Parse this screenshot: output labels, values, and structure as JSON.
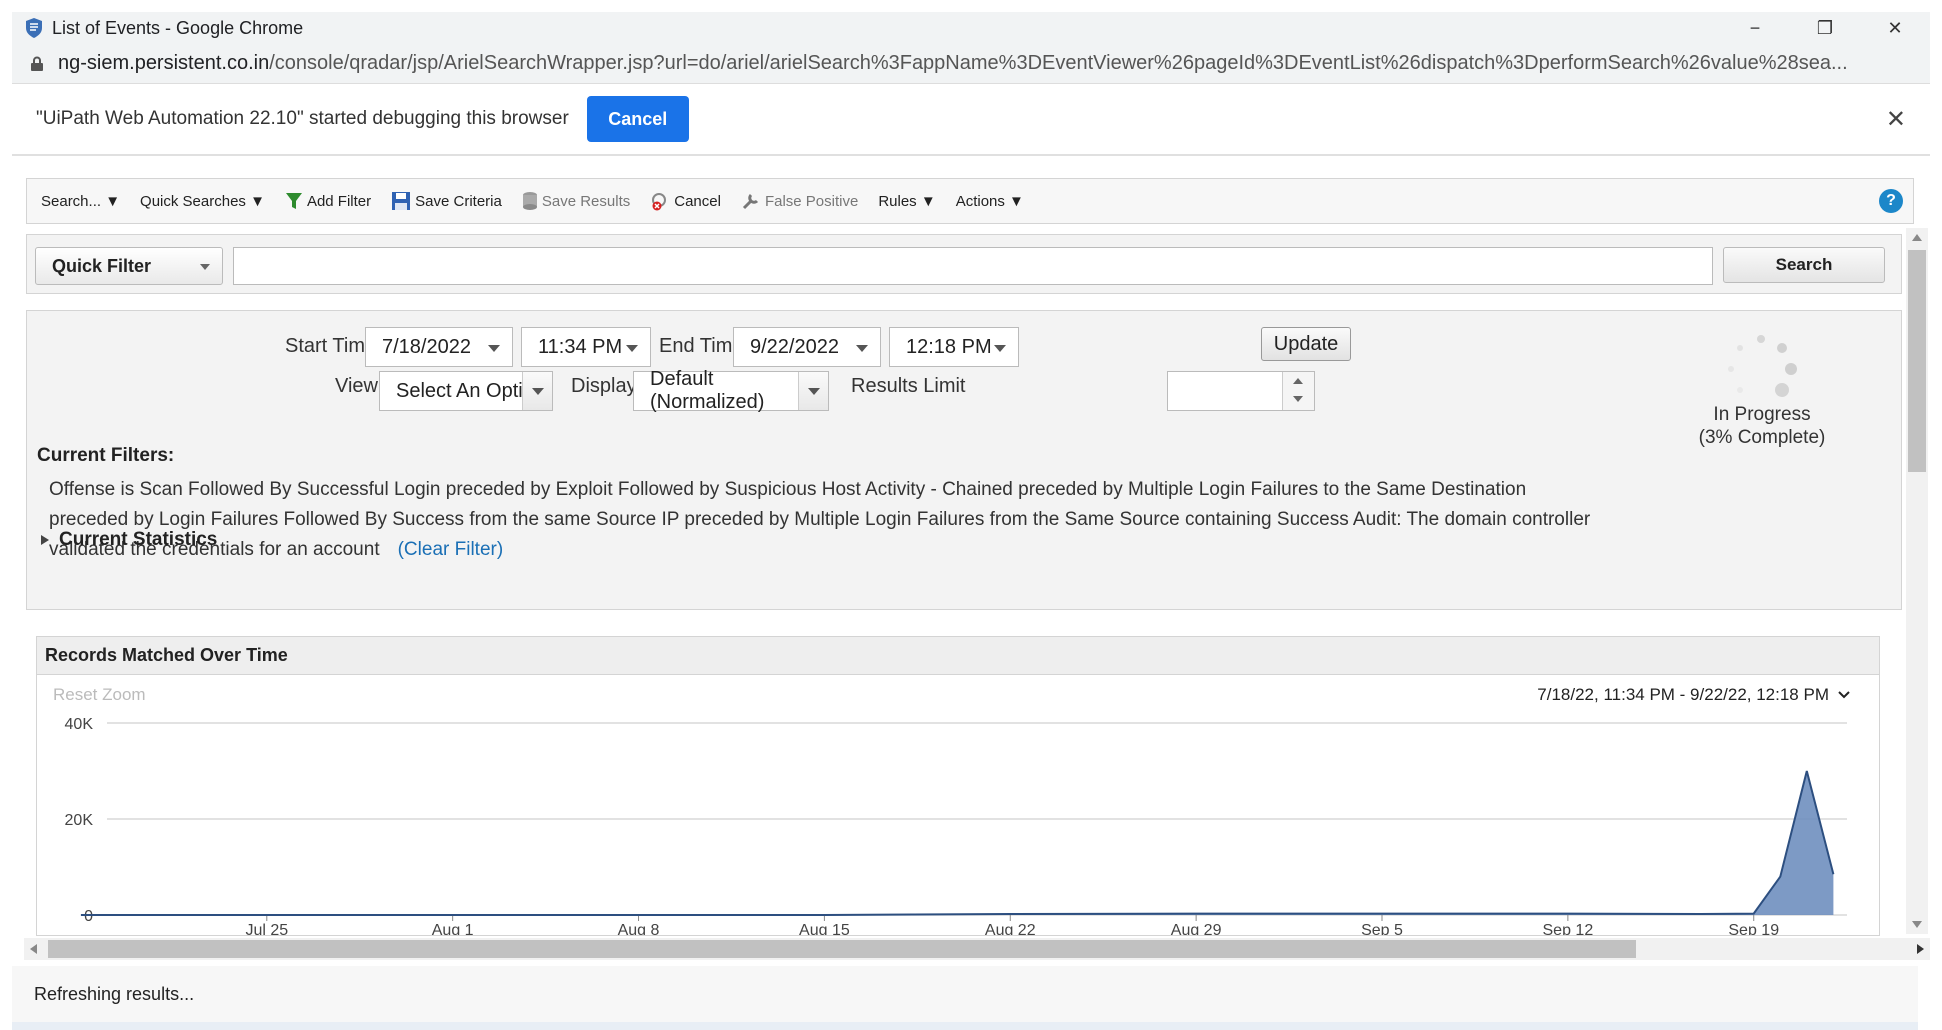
{
  "window": {
    "title": "List of Events - Google Chrome",
    "minimize": "−",
    "restore": "❐",
    "close": "✕"
  },
  "address": {
    "host": "ng-siem.persistent.co.in",
    "path": "/console/qradar/jsp/ArielSearchWrapper.jsp?url=do/ariel/arielSearch%3FappName%3DEventViewer%26pageId%3DEventList%26dispatch%3DperformSearch%26value%28sea..."
  },
  "infobar": {
    "message": "\"UiPath Web Automation 22.10\" started debugging this browser",
    "cancel_label": "Cancel",
    "close": "✕"
  },
  "toolbar": {
    "search": "Search... ▼",
    "quick_searches": "Quick Searches ▼",
    "add_filter": "Add Filter",
    "save_criteria": "Save Criteria",
    "save_results": "Save Results",
    "cancel": "Cancel",
    "false_positive": "False Positive",
    "rules": "Rules ▼",
    "actions": "Actions ▼",
    "help": "?"
  },
  "quick_filter": {
    "select_value": "Quick Filter",
    "input_value": "",
    "search_label": "Search"
  },
  "criteria": {
    "start_time_label": "Start Time",
    "start_date": "7/18/2022",
    "start_time": "11:34 PM",
    "end_time_label": "End Time",
    "end_date": "9/22/2022",
    "end_time": "12:18 PM",
    "update_label": "Update",
    "view_label": "View:",
    "view_value": "Select An Option:",
    "display_label": "Display:",
    "display_value": "Default (Normalized)",
    "results_limit_label": "Results Limit",
    "results_limit_value": "",
    "progress_line1": "In Progress",
    "progress_line2": "(3% Complete)",
    "current_filters_title": "Current Filters:",
    "current_filters_text": "Offense is Scan Followed By Successful Login preceded by Exploit Followed by Suspicious Host Activity - Chained preceded by Multiple Login Failures to the Same Destination preceded by Login Failures Followed By Success from the same Source IP preceded by Multiple Login Failures from the Same Source containing Success Audit: The domain controller validated the credentials for an account",
    "clear_filter": "(Clear Filter)",
    "current_statistics": "Current Statistics"
  },
  "chart_panel": {
    "title": "Records Matched Over Time",
    "reset_zoom": "Reset Zoom",
    "range_text": "7/18/22, 11:34 PM - 9/22/22, 12:18 PM"
  },
  "chart_data": {
    "type": "area",
    "title": "",
    "xlabel": "",
    "ylabel": "",
    "ylim": [
      0,
      40000
    ],
    "y_ticks": [
      "0",
      "20K",
      "40K"
    ],
    "x_ticks": [
      "Jul 25",
      "Aug 1",
      "Aug 8",
      "Aug 15",
      "Aug 22",
      "Aug 29",
      "Sep 5",
      "Sep 12",
      "Sep 19"
    ],
    "grid": true,
    "color": "#6f8fbf",
    "series": [
      {
        "x": [
          "Jul 18",
          "Jul 25",
          "Aug 1",
          "Aug 8",
          "Aug 15",
          "Aug 22",
          "Aug 29",
          "Sep 5",
          "Sep 12",
          "Sep 17",
          "Sep 19",
          "Sep 20",
          "Sep 21",
          "Sep 22"
        ],
        "values": [
          0,
          0,
          0,
          0,
          0,
          200,
          300,
          300,
          300,
          200,
          300,
          8000,
          30000,
          8500
        ]
      }
    ]
  },
  "status": {
    "text": "Refreshing results..."
  }
}
